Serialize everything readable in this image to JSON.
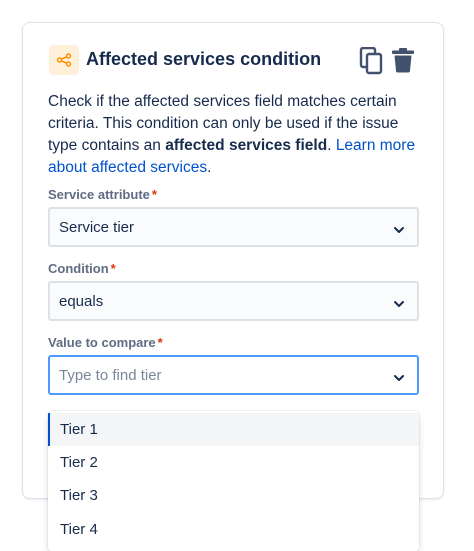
{
  "card": {
    "title": "Affected services condition",
    "icons": {
      "header": "services-connection-icon",
      "copy": "copy-icon",
      "delete": "trash-icon"
    },
    "description": {
      "text_before": "Check if the affected services field matches certain criteria. This condition can only be used if the issue type contains an ",
      "bold": "affected services field",
      "text_after": ". ",
      "link": "Learn more about affected services",
      "end": "."
    }
  },
  "fields": {
    "service_attribute": {
      "label": "Service attribute",
      "required_mark": "*",
      "value": "Service tier"
    },
    "condition": {
      "label": "Condition",
      "required_mark": "*",
      "value": "equals"
    },
    "value_to_compare": {
      "label": "Value to compare",
      "required_mark": "*",
      "placeholder": "Type to find tier"
    }
  },
  "dropdown": {
    "options": [
      "Tier 1",
      "Tier 2",
      "Tier 3",
      "Tier 4"
    ],
    "active_index": 0
  },
  "colors": {
    "accent": "#0052cc",
    "focus_border": "#4c9aff",
    "required": "#de350b",
    "icon_bg": "#fff0d9",
    "icon_fg": "#ff8b00"
  }
}
